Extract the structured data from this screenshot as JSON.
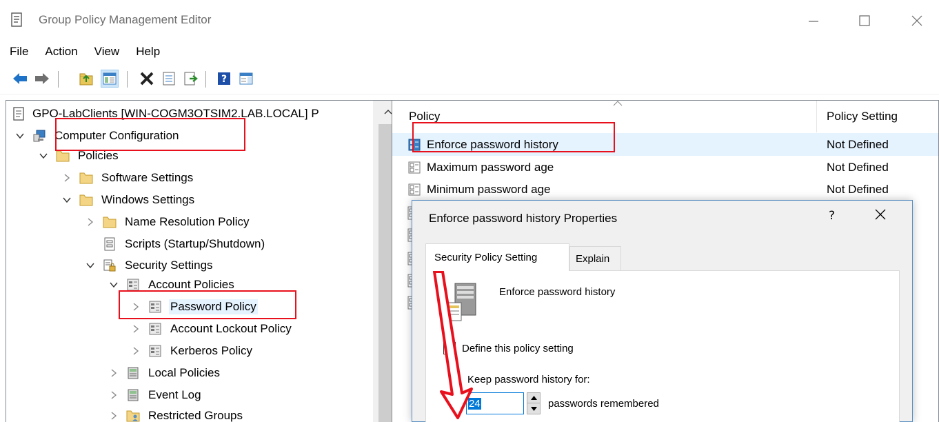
{
  "window": {
    "title": "Group Policy Management Editor",
    "minimize": "—",
    "maximize": "☐",
    "close": "✕"
  },
  "menu": [
    "File",
    "Action",
    "View",
    "Help"
  ],
  "toolbar": [
    "back-icon",
    "forward-icon",
    "up-folder-icon",
    "show-hide-tree-icon",
    "delete-icon",
    "properties-icon",
    "export-list-icon",
    "help-icon",
    "action-pane-icon"
  ],
  "tree": {
    "root": "GPO-LabClients [WIN-COGM3OTSIM2.LAB.LOCAL] P",
    "items": [
      {
        "label": "Computer Configuration"
      },
      {
        "label": "Policies"
      },
      {
        "label": "Software Settings"
      },
      {
        "label": "Windows Settings"
      },
      {
        "label": "Name Resolution Policy"
      },
      {
        "label": "Scripts (Startup/Shutdown)"
      },
      {
        "label": "Security Settings"
      },
      {
        "label": "Account Policies"
      },
      {
        "label": "Password Policy"
      },
      {
        "label": "Account Lockout Policy"
      },
      {
        "label": "Kerberos Policy"
      },
      {
        "label": "Local Policies"
      },
      {
        "label": "Event Log"
      },
      {
        "label": "Restricted Groups"
      }
    ]
  },
  "list": {
    "col_policy": "Policy",
    "col_setting": "Policy Setting",
    "rows": [
      {
        "name": "Enforce password history",
        "setting": "Not Defined"
      },
      {
        "name": "Maximum password age",
        "setting": "Not Defined"
      },
      {
        "name": "Minimum password age",
        "setting": "Not Defined"
      }
    ]
  },
  "dialog": {
    "title": "Enforce password history Properties",
    "help": "?",
    "close": "✕",
    "tab_active": "Security Policy Setting",
    "tab_inactive": "Explain",
    "policy_name": "Enforce password history",
    "checkbox_label": "Define this policy setting",
    "keep_label": "Keep password history for:",
    "value": "24",
    "units": "passwords remembered"
  },
  "colors": {
    "highlight_box": "#e8101c",
    "selection": "#e5f3ff",
    "input_focus": "#0078d7"
  }
}
